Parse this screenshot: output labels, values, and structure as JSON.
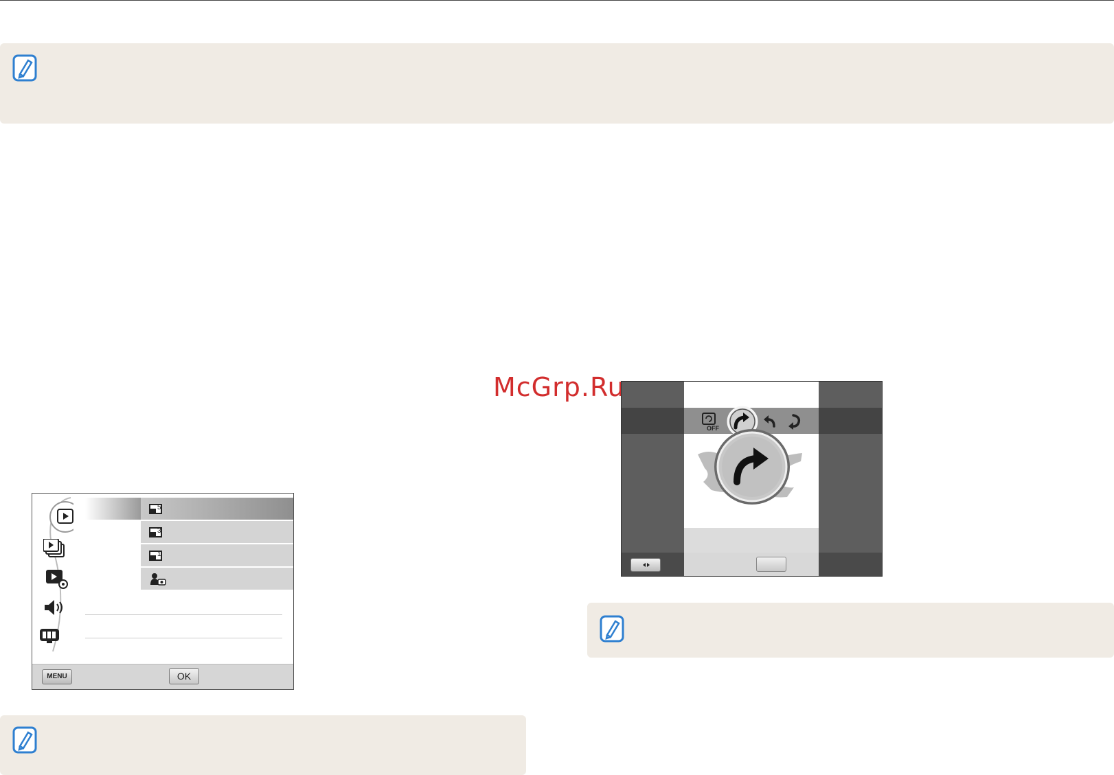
{
  "watermark": "McGrp.Ru",
  "menu_screen": {
    "menu_button": "MENU",
    "ok_button": "OK",
    "left_icons": [
      "play-icon",
      "slideshow-icon",
      "playback-settings-icon",
      "sound-icon",
      "display-icon"
    ],
    "rows": [
      {
        "value_icon": "resize-5m-icon",
        "selected": true
      },
      {
        "value_icon": "resize-3m-icon",
        "selected": false
      },
      {
        "value_icon": "resize-1m-icon",
        "selected": false
      },
      {
        "value_icon": "start-image-icon",
        "selected": false
      }
    ]
  },
  "rotate_screen": {
    "options": [
      "rotate-off-icon",
      "rotate-right-90-icon",
      "rotate-left-90-icon",
      "rotate-180-icon"
    ],
    "selected_option": "rotate-right-90-icon"
  },
  "colors": {
    "note_background": "#f0ebe4",
    "note_icon": "#2e7fd0",
    "watermark": "#d22d2d"
  }
}
